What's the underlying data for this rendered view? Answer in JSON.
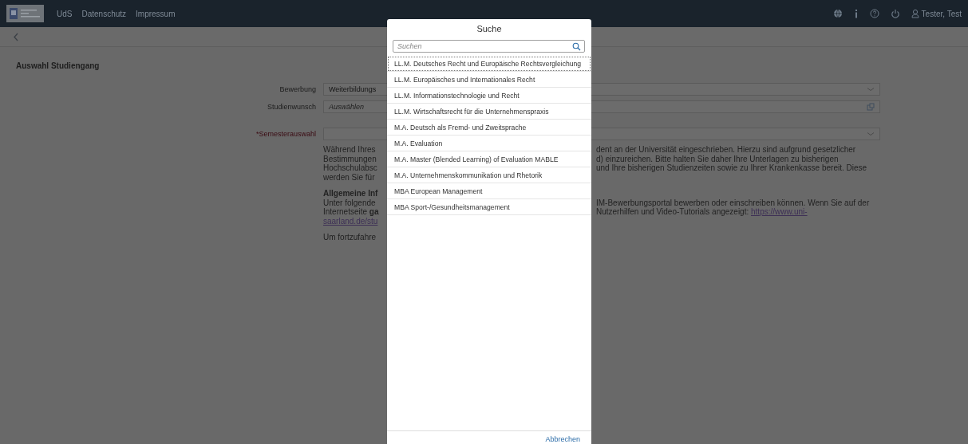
{
  "header": {
    "nav_links": [
      "UdS",
      "Datenschutz",
      "Impressum"
    ],
    "user": "Tester, Test"
  },
  "page": {
    "title": "Auswahl Studiengang",
    "fields": [
      {
        "label": "Bewerbung",
        "kind": "select",
        "value": "Weiterbildungs",
        "required": false
      },
      {
        "label": "Studienwunsch",
        "kind": "valuehelp",
        "placeholder": "Auswählen",
        "required": false
      },
      {
        "label": "*Semesterauswahl",
        "kind": "select",
        "required": true
      }
    ],
    "info_rows": [
      {
        "kind": "text",
        "left": "Während Ihres",
        "right": "dent an der Universität eingeschrieben. Hierzu sind aufgrund gesetzlicher"
      },
      {
        "kind": "text",
        "left": "Bestimmungen",
        "right": "d) einzureichen. Bitte halten Sie daher Ihre Unterlagen zu bisherigen"
      },
      {
        "kind": "text",
        "left": "Hochschulabsc",
        "right": "und Ihre bisherigen Studienzeiten sowie zu Ihrer Krankenkasse bereit. Diese"
      },
      {
        "kind": "text",
        "left": "werden Sie für"
      },
      {
        "kind": "heading",
        "left": "Allgemeine Inf"
      },
      {
        "kind": "text",
        "left": "Unter folgende",
        "right": "IM-Bewerbungsportal bewerben oder einschreiben können. Wenn Sie auf der"
      },
      {
        "kind": "text",
        "left": "Internetseite **ga**",
        "right": "Nutzerhilfen und Video-Tutorials angezeigt: ",
        "right_link": "https://www.uni-"
      },
      {
        "kind": "text",
        "left_link": "saarland.de/stu"
      },
      {
        "kind": "note",
        "left": "Um fortzufahre"
      }
    ]
  },
  "dialog": {
    "title": "Suche",
    "search": {
      "placeholder": "Suchen"
    },
    "items": [
      {
        "label": "LL.M. Deutsches Recht und Europäische Rechtsvergleichung",
        "focused": true
      },
      {
        "label": "LL.M. Europäisches und Internationales Recht",
        "focused": false
      },
      {
        "label": "LL.M. Informationstechnologie und Recht",
        "focused": false
      },
      {
        "label": "LL.M. Wirtschaftsrecht für die Unternehmenspraxis",
        "focused": false
      },
      {
        "label": "M.A. Deutsch als Fremd- und Zweitsprache",
        "focused": false
      },
      {
        "label": "M.A. Evaluation",
        "focused": false
      },
      {
        "label": "M.A. Master (Blended Learning) of Evaluation MABLE",
        "focused": false
      },
      {
        "label": "M.A. Unternehmenskommunikation und Rhetorik",
        "focused": false
      },
      {
        "label": "MBA European Management",
        "focused": false
      },
      {
        "label": "MBA Sport-/Gesundheitsmanagement",
        "focused": false
      }
    ],
    "cancel": "Abbrechen"
  }
}
